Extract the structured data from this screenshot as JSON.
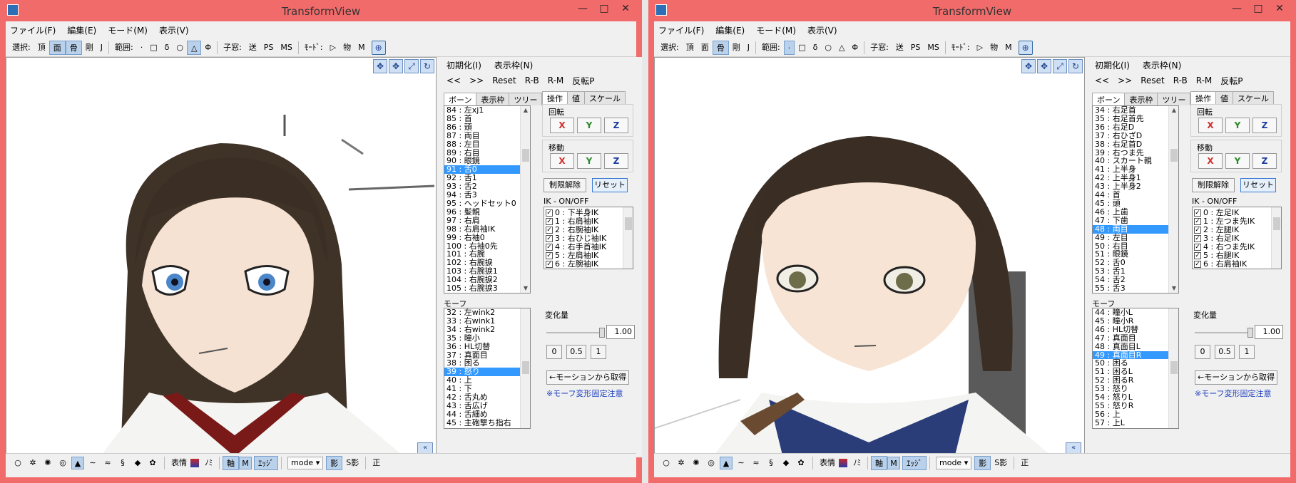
{
  "windows": [
    {
      "title": "TransformView",
      "menu": [
        "ファイル(F)",
        "編集(E)",
        "モード(M)",
        "表示(V)"
      ],
      "toolbar": {
        "select_label": "選択:",
        "select_items": [
          "頂",
          "面",
          "骨",
          "剛",
          "J"
        ],
        "range_label": "範囲:",
        "range_items": [
          "·",
          "□",
          "δ",
          "○",
          "△",
          "Φ"
        ],
        "child_label": "子窓:",
        "child_items": [
          "送",
          "PS",
          "MS"
        ],
        "mode_label": "ﾓｰﾄﾞ:",
        "mode_items": [
          "▷",
          "物",
          "M"
        ]
      },
      "side": {
        "init": "初期化(I)",
        "frame": "表示枠(N)",
        "prev": "<<",
        "next": ">>",
        "reset": "Reset",
        "rb": "R-B",
        "rm": "R-M",
        "flip": "反転P",
        "tabs": [
          "ボーン",
          "表示枠",
          "ツリー"
        ],
        "op_tabs": [
          "操作",
          "値",
          "スケール"
        ],
        "rotate": "回転",
        "move": "移動",
        "x": "X",
        "y": "Y",
        "z": "Z",
        "unlimit": "制限解除",
        "reset_btn": "リセット",
        "ik_label": "IK - ON/OFF",
        "morph_label": "モーフ",
        "change_label": "変化量",
        "value": "1.00",
        "v0": "0",
        "v05": "0.5",
        "v1": "1",
        "from_motion": "←モーションから取得",
        "note": "※モーフ変形固定注意"
      },
      "bones": [
        "84 : 左xj1",
        "85 : 首",
        "86 : 頭",
        "87 : 両目",
        "88 : 左目",
        "89 : 右目",
        "90 : 眼鏡",
        "91 : 舌0",
        "92 : 舌1",
        "93 : 舌2",
        "94 : 舌3",
        "95 : ヘッドセット0",
        "96 : 髪親",
        "97 : 右肩",
        "98 : 右肩袖IK",
        "99 : 右袖0",
        "100 : 右袖0先",
        "101 : 右腕",
        "102 : 右腕捩",
        "103 : 右腕捩1",
        "104 : 右腕捩2",
        "105 : 右腕捩3"
      ],
      "bones_selected": 7,
      "ik": [
        "0 : 下半身IK",
        "1 : 右肩袖IK",
        "2 : 右腕袖IK",
        "3 : 右ひじ袖IK",
        "4 : 右手首袖IK",
        "5 : 左肩袖IK",
        "6 : 左腕袖IK"
      ],
      "morphs": [
        "32 : 左wink2",
        "33 : 右wink1",
        "34 : 右wink2",
        "35 : 瞳小",
        "36 : HL切替",
        "37 : 真面目",
        "38 : 困る",
        "39 : 怒り",
        "40 : 上",
        "41 : 下",
        "42 : 舌丸め",
        "43 : 舌広げ",
        "44 : 舌細め",
        "45 : 主砲撃ち指右"
      ],
      "morphs_selected": 7,
      "bottom": {
        "face": "表情",
        "nomi": "ﾉﾐ",
        "axis": "軸",
        "edge": "ｴｯｼﾞ",
        "mode": "mode",
        "shadow": "影",
        "sshadow": "S影",
        "ortho": "正"
      }
    },
    {
      "title": "TransformView",
      "menu": [
        "ファイル(F)",
        "編集(E)",
        "モード(M)",
        "表示(V)"
      ],
      "toolbar": {
        "select_label": "選択:",
        "select_items": [
          "頂",
          "面",
          "骨",
          "剛",
          "J"
        ],
        "range_label": "範囲:",
        "range_items": [
          "·",
          "□",
          "δ",
          "○",
          "△",
          "Φ"
        ],
        "child_label": "子窓:",
        "child_items": [
          "送",
          "PS",
          "MS"
        ],
        "mode_label": "ﾓｰﾄﾞ:",
        "mode_items": [
          "▷",
          "物",
          "M"
        ]
      },
      "side": {
        "init": "初期化(I)",
        "frame": "表示枠(N)",
        "prev": "<<",
        "next": ">>",
        "reset": "Reset",
        "rb": "R-B",
        "rm": "R-M",
        "flip": "反転P",
        "tabs": [
          "ボーン",
          "表示枠",
          "ツリー"
        ],
        "op_tabs": [
          "操作",
          "値",
          "スケール"
        ],
        "rotate": "回転",
        "move": "移動",
        "x": "X",
        "y": "Y",
        "z": "Z",
        "unlimit": "制限解除",
        "reset_btn": "リセット",
        "ik_label": "IK - ON/OFF",
        "morph_label": "モーフ",
        "change_label": "変化量",
        "value": "1.00",
        "v0": "0",
        "v05": "0.5",
        "v1": "1",
        "from_motion": "←モーションから取得",
        "note": "※モーフ変形固定注意"
      },
      "bones": [
        "34 : 右足首",
        "35 : 右足首先",
        "36 : 右足D",
        "37 : 右ひざD",
        "38 : 右足首D",
        "39 : 右つま先",
        "40 : スカート親",
        "41 : 上半身",
        "42 : 上半身1",
        "43 : 上半身2",
        "44 : 首",
        "45 : 頭",
        "46 : 上歯",
        "47 : 下歯",
        "48 : 両目",
        "49 : 左目",
        "50 : 右目",
        "51 : 眼鏡",
        "52 : 舌0",
        "53 : 舌1",
        "54 : 舌2",
        "55 : 舌3"
      ],
      "bones_selected": 14,
      "ik": [
        "0 : 左足IK",
        "1 : 左つま先IK",
        "2 : 左腿IK",
        "3 : 右足IK",
        "4 : 右つま先IK",
        "5 : 右腿IK",
        "6 : 右肩袖IK"
      ],
      "morphs": [
        "44 : 瞳小L",
        "45 : 瞳小R",
        "46 : HL切替",
        "47 : 真面目",
        "48 : 真面目L",
        "49 : 真面目R",
        "50 : 困る",
        "51 : 困るL",
        "52 : 困るR",
        "53 : 怒り",
        "54 : 怒りL",
        "55 : 怒りR",
        "56 : 上",
        "57 : 上L"
      ],
      "morphs_selected": 5,
      "bottom": {
        "face": "表情",
        "nomi": "ﾉﾐ",
        "axis": "軸",
        "edge": "ｴｯｼﾞ",
        "mode": "mode",
        "shadow": "影",
        "sshadow": "S影",
        "ortho": "正"
      }
    }
  ],
  "colors": {
    "titlebar": "#f26b6b",
    "selection": "#3399ff",
    "x": "#d03030",
    "y": "#2a8a2a",
    "z": "#1a3aa0"
  }
}
